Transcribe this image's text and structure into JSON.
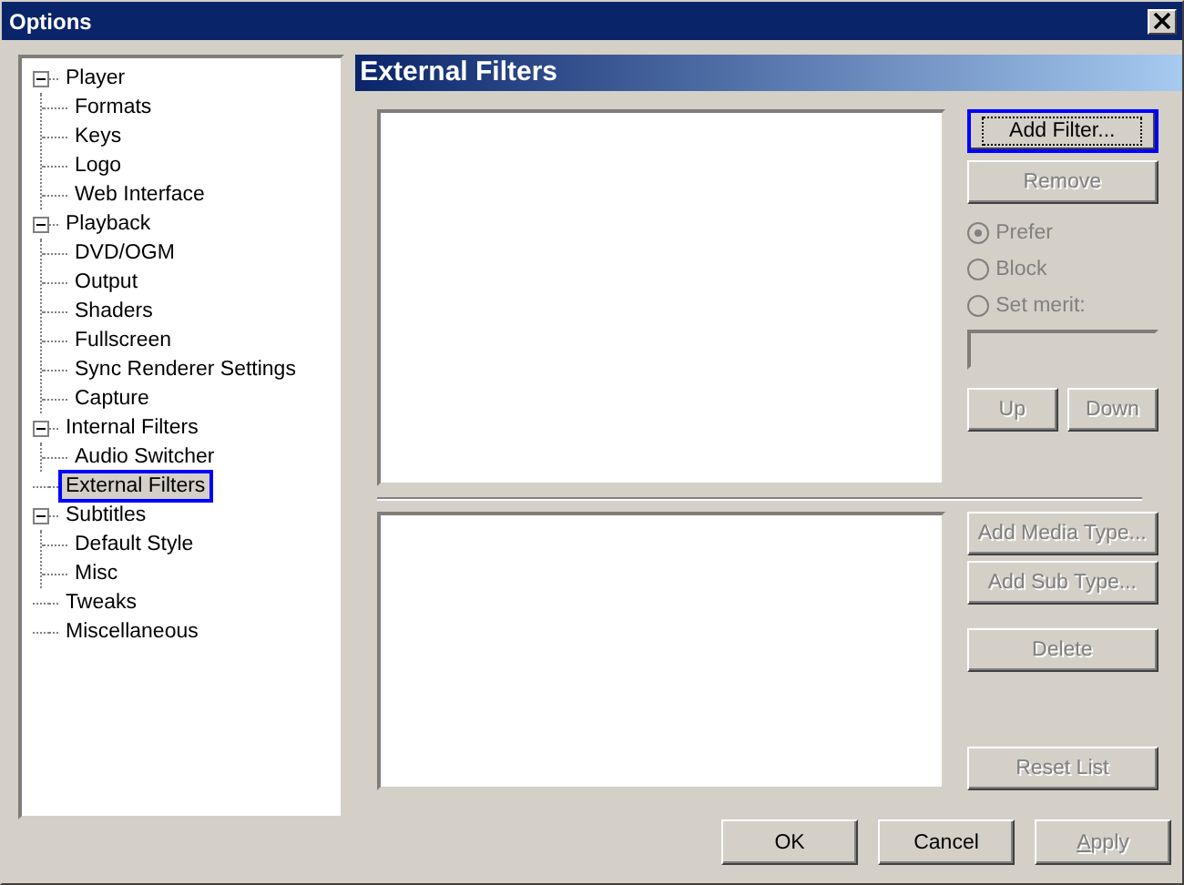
{
  "window": {
    "title": "Options"
  },
  "tree": [
    {
      "label": "Player",
      "expanded": true,
      "selected": false,
      "children": [
        {
          "label": "Formats",
          "selected": false
        },
        {
          "label": "Keys",
          "selected": false
        },
        {
          "label": "Logo",
          "selected": false
        },
        {
          "label": "Web Interface",
          "selected": false
        }
      ]
    },
    {
      "label": "Playback",
      "expanded": true,
      "selected": false,
      "children": [
        {
          "label": "DVD/OGM",
          "selected": false
        },
        {
          "label": "Output",
          "selected": false
        },
        {
          "label": "Shaders",
          "selected": false
        },
        {
          "label": "Fullscreen",
          "selected": false
        },
        {
          "label": "Sync Renderer Settings",
          "selected": false
        },
        {
          "label": "Capture",
          "selected": false
        }
      ]
    },
    {
      "label": "Internal Filters",
      "expanded": true,
      "selected": false,
      "children": [
        {
          "label": "Audio Switcher",
          "selected": false
        }
      ]
    },
    {
      "label": "External Filters",
      "selected": true
    },
    {
      "label": "Subtitles",
      "expanded": true,
      "selected": false,
      "children": [
        {
          "label": "Default Style",
          "selected": false
        },
        {
          "label": "Misc",
          "selected": false
        }
      ]
    },
    {
      "label": "Tweaks",
      "selected": false
    },
    {
      "label": "Miscellaneous",
      "selected": false
    }
  ],
  "page_title": "External Filters",
  "filter_buttons": [
    {
      "label": "Add Filter...",
      "disabled": false,
      "default": true
    },
    {
      "label": "Remove",
      "disabled": true,
      "default": false
    }
  ],
  "merit_options": [
    {
      "label": "Prefer",
      "selected": true,
      "disabled": true
    },
    {
      "label": "Block",
      "selected": false,
      "disabled": true
    },
    {
      "label": "Set merit:",
      "selected": false,
      "disabled": true
    }
  ],
  "merit_field": {
    "disabled": true
  },
  "order_buttons": [
    {
      "label": "Up",
      "disabled": true
    },
    {
      "label": "Down",
      "disabled": true
    }
  ],
  "type_buttons": [
    {
      "label": "Add Media Type...",
      "disabled": true
    },
    {
      "label": "Add Sub Type...",
      "disabled": true
    },
    {
      "label": "Delete",
      "disabled": true
    }
  ],
  "reset_button": {
    "label": "Reset List",
    "disabled": true
  },
  "dialog_buttons": [
    {
      "label": "OK",
      "disabled": false
    },
    {
      "label": "Cancel",
      "disabled": false
    },
    {
      "label": "Apply",
      "disabled": true
    }
  ]
}
